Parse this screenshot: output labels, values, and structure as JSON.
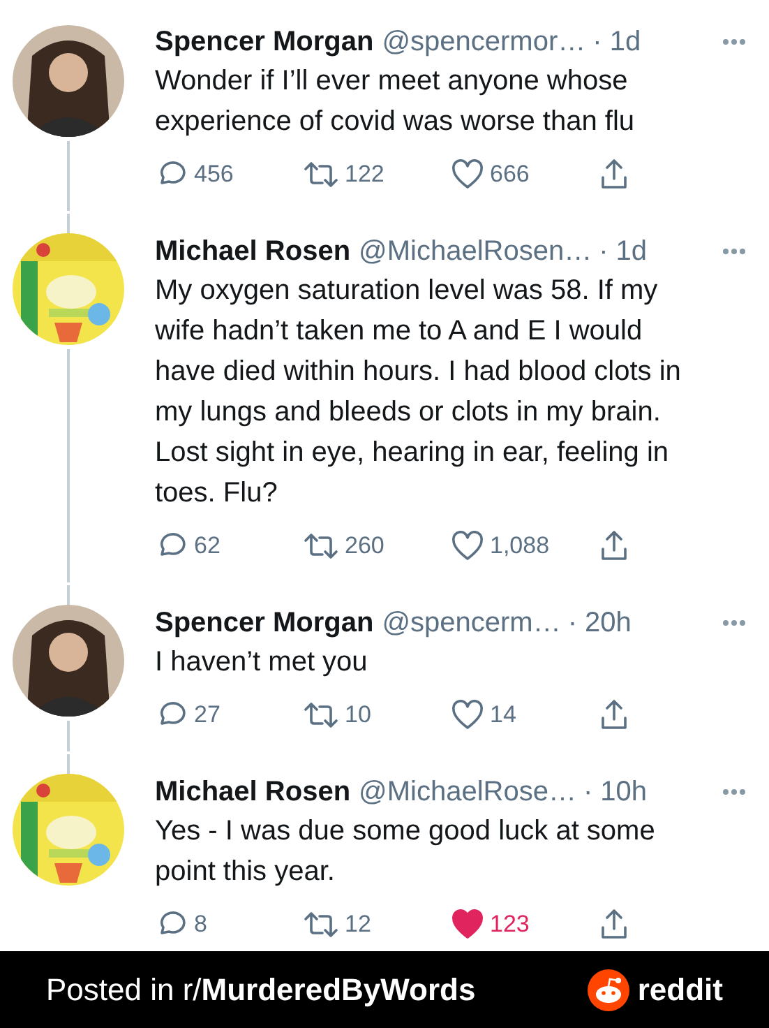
{
  "tweets": [
    {
      "avatar": {
        "kind": "person"
      },
      "name": "Spencer Morgan",
      "handle": "@spencermor…",
      "time": "· 1d",
      "text": "Wonder if I’ll ever meet anyone whose experience of covid was worse than flu",
      "replies": "456",
      "retweets": "122",
      "likes": "666",
      "liked": false
    },
    {
      "name": "Michael Rosen",
      "handle": "@MichaelRosen…",
      "time": "· 1d",
      "text": "My oxygen saturation level was 58. If my wife hadn’t taken me to A and E I would have died within hours. I had blood clots in my lungs and bleeds or clots in my brain. Lost sight in eye, hearing in ear, feeling in toes. Flu?",
      "replies": "62",
      "retweets": "260",
      "likes": "1,088",
      "liked": false
    },
    {
      "avatar": {
        "kind": "person"
      },
      "name": "Spencer Morgan",
      "handle": "@spencerm…",
      "time": "· 20h",
      "text": "I haven’t met you",
      "replies": "27",
      "retweets": "10",
      "likes": "14",
      "liked": false
    },
    {
      "name": "Michael Rosen",
      "handle": "@MichaelRose…",
      "time": "· 10h",
      "text": "Yes -  I was due some good luck at some point this year.",
      "replies": "8",
      "retweets": "12",
      "likes": "123",
      "liked": true
    }
  ],
  "banner": {
    "text": "Posted in r/**MurderedByWords**",
    "brand": "reddit"
  }
}
